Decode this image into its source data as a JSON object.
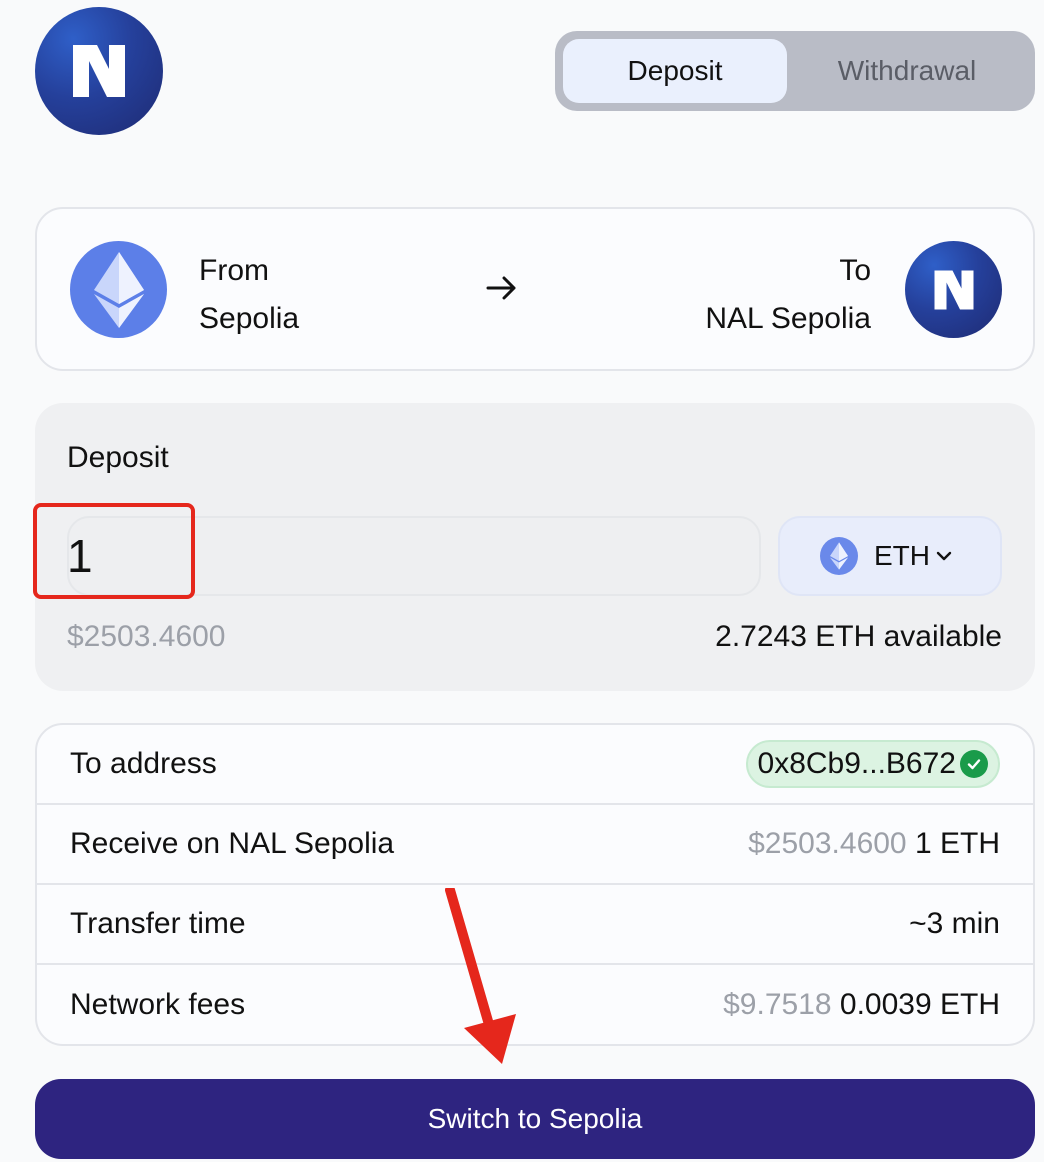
{
  "header": {
    "logo_icon": "nal-logo-icon",
    "tabs": [
      {
        "label": "Deposit",
        "active": true
      },
      {
        "label": "Withdrawal",
        "active": false
      }
    ]
  },
  "route": {
    "from_label": "From",
    "from_network": "Sepolia",
    "from_icon": "ethereum-icon",
    "arrow_icon": "arrow-right-icon",
    "to_label": "To",
    "to_network": "NAL Sepolia",
    "to_icon": "nal-logo-icon"
  },
  "deposit": {
    "title": "Deposit",
    "amount": "1",
    "usd_value": "$2503.4600",
    "token": "ETH",
    "token_icon": "ethereum-icon",
    "available": "2.7243 ETH available"
  },
  "details": {
    "to_address_label": "To address",
    "to_address_value": "0x8Cb9...B672",
    "receive_label": "Receive on NAL Sepolia",
    "receive_usd": "$2503.4600",
    "receive_amount": "1 ETH",
    "transfer_time_label": "Transfer time",
    "transfer_time_value": "~3 min",
    "network_fees_label": "Network fees",
    "network_fees_usd": "$9.7518",
    "network_fees_amount": "0.0039 ETH"
  },
  "action": {
    "button_label": "Switch to Sepolia"
  },
  "colors": {
    "primary": "#2e2480",
    "annotation": "#e5271c",
    "success": "#1a9b4a"
  }
}
